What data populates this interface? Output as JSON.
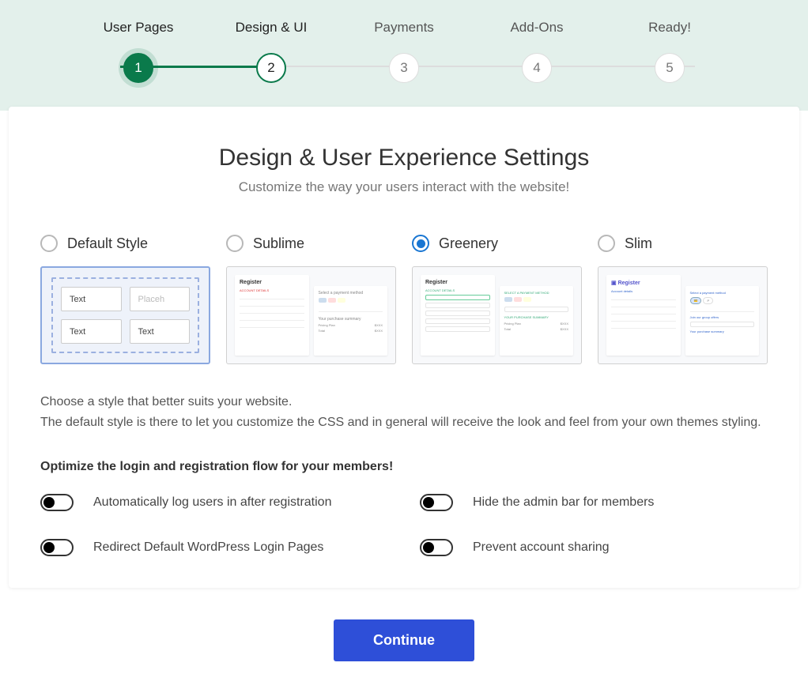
{
  "stepper": {
    "steps": [
      {
        "label": "User Pages",
        "num": "1",
        "state": "done"
      },
      {
        "label": "Design & UI",
        "num": "2",
        "state": "current"
      },
      {
        "label": "Payments",
        "num": "3",
        "state": "pending"
      },
      {
        "label": "Add-Ons",
        "num": "4",
        "state": "pending"
      },
      {
        "label": "Ready!",
        "num": "5",
        "state": "pending"
      }
    ]
  },
  "heading": {
    "title": "Design & User Experience Settings",
    "subtitle": "Customize the way your users interact with the website!"
  },
  "styles": [
    {
      "name": "Default Style",
      "selected": false,
      "preview_text": {
        "a": "Text",
        "b": "Placeh",
        "c": "Text",
        "d": "Text"
      }
    },
    {
      "name": "Sublime",
      "selected": false
    },
    {
      "name": "Greenery",
      "selected": true
    },
    {
      "name": "Slim",
      "selected": false
    }
  ],
  "preview_register_label": "Register",
  "description": {
    "line1": "Choose a style that better suits your website.",
    "line2": "The default style is there to let you customize the CSS and in general will receive the look and feel from your own themes styling."
  },
  "optimize_heading": "Optimize the login and registration flow for your members!",
  "toggles": [
    {
      "label": "Automatically log users in after registration",
      "on": false
    },
    {
      "label": "Hide the admin bar for members",
      "on": false
    },
    {
      "label": "Redirect Default WordPress Login Pages",
      "on": false
    },
    {
      "label": "Prevent account sharing",
      "on": false
    }
  ],
  "continue_label": "Continue"
}
